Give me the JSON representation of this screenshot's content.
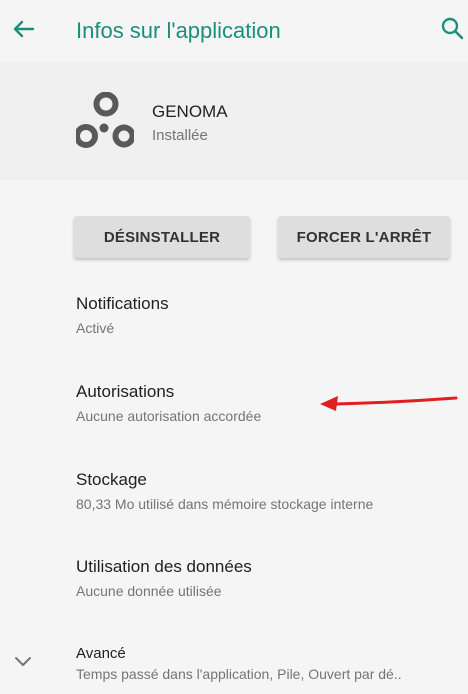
{
  "app_bar": {
    "title": "Infos sur l'application",
    "back_icon": "arrow-left-icon",
    "search_icon": "search-icon"
  },
  "app": {
    "name": "GENOMA",
    "status": "Installée",
    "icon": "genoma-logo-icon"
  },
  "buttons": {
    "uninstall_label": "DÉSINSTALLER",
    "force_stop_label": "FORCER L'ARRÊT"
  },
  "items": [
    {
      "title": "Notifications",
      "subtitle": "Activé"
    },
    {
      "title": "Autorisations",
      "subtitle": "Aucune autorisation accordée"
    },
    {
      "title": "Stockage",
      "subtitle": "80,33 Mo utilisé dans mémoire stockage interne"
    },
    {
      "title": "Utilisation des données",
      "subtitle": "Aucune donnée utilisée"
    }
  ],
  "advanced": {
    "title": "Avancé",
    "subtitle": "Temps passé dans l'application, Pile, Ouvert par dé..",
    "icon": "chevron-down-icon"
  },
  "annotation": {
    "icon": "red-arrow-icon"
  },
  "colors": {
    "accent": "#1b8f79",
    "background": "#f5f5f5",
    "button": "#dedede",
    "annotation_arrow": "#e02020"
  }
}
